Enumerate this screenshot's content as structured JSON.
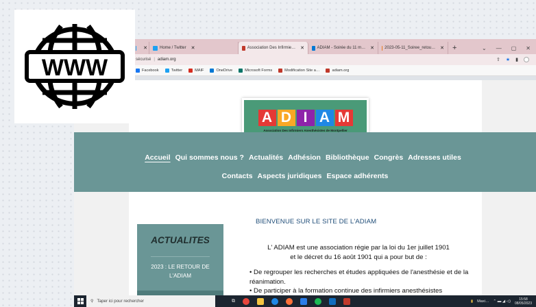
{
  "browser": {
    "tabs": [
      {
        "label": "",
        "close": "✕",
        "color": "#1da1f2",
        "active": false
      },
      {
        "label": "Home / Twitter",
        "close": "✕",
        "color": "#1da1f2",
        "active": false
      },
      {
        "label": "Association Des Infirmie…",
        "close": "✕",
        "color": "#c0392b",
        "active": true
      },
      {
        "label": "ADIAM - Soirée du 11 m…",
        "close": "✕",
        "color": "#0078d4",
        "active": false
      },
      {
        "label": "2023-05-11_Soiree_retou…",
        "close": "✕",
        "color": "#e67e22",
        "active": false
      }
    ],
    "new_tab": "+",
    "window_controls": [
      "⌄",
      "—",
      "▢",
      "✕"
    ],
    "address": {
      "security": "sécurisé",
      "url": "adiam.org"
    },
    "bookmarks": [
      {
        "label": "Facebook",
        "color": "#1877f2"
      },
      {
        "label": "Twitter",
        "color": "#1da1f2"
      },
      {
        "label": "MAIF",
        "color": "#d62d20"
      },
      {
        "label": "OneDrive",
        "color": "#0078d4"
      },
      {
        "label": "Microsoft Forms",
        "color": "#077568"
      },
      {
        "label": "Modification Site a…",
        "color": "#c0392b"
      },
      {
        "label": "adiam.org",
        "color": "#c0392b"
      }
    ]
  },
  "logo": {
    "letters": [
      {
        "char": "A",
        "color": "#e53935"
      },
      {
        "char": "D",
        "color": "#f9a825"
      },
      {
        "char": "I",
        "color": "#8e24aa"
      },
      {
        "char": "A",
        "color": "#1e88e5"
      },
      {
        "char": "M",
        "color": "#e53935"
      }
    ],
    "subtitle": "Association Des Infirmiers Anesthésistes de Montpellier"
  },
  "nav": {
    "row1": [
      "Accueil",
      "Qui sommes nous ?",
      "Actualités",
      "Adhésion",
      "Bibliothèque",
      "Congrès",
      "Adresses utiles"
    ],
    "row2": [
      "Contacts",
      "Aspects juridiques",
      "Espace adhérents"
    ],
    "active": "Accueil"
  },
  "sidebar": {
    "title": "ACTUALITES",
    "news_item": "2023 : LE RETOUR DE L'ADIAM"
  },
  "main": {
    "welcome": "BIENVENUE SUR LE SITE DE L'ADIAM",
    "intro_line1": "L' ADIAM est une association régie par la loi du 1er juillet 1901",
    "intro_line2": "et le décret du 16 août 1901 qui a pour but de :",
    "bullet1": "• De regrouper les recherches et études appliquées de l'anesthésie et de la réanimation.",
    "bullet2": "• De participer à la formation continue des infirmiers anesthésistes"
  },
  "taskbar": {
    "search_placeholder": "Taper ici pour rechercher",
    "weather": "Maxi…",
    "time": "15:58",
    "date": "08/05/2023"
  },
  "www_icon": {
    "label": "WWW"
  }
}
